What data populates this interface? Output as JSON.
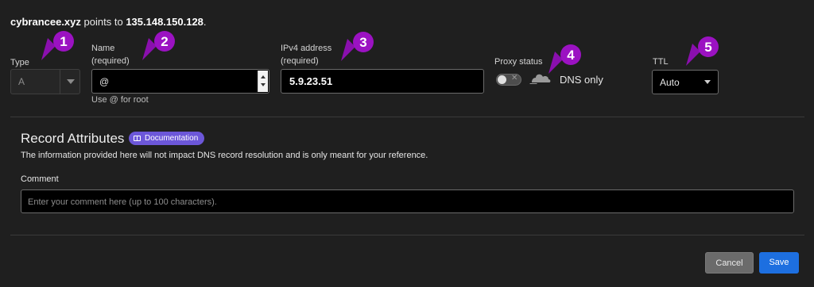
{
  "summary": {
    "domain": "cybrancee.xyz",
    "points_to_text": "points to",
    "ip": "135.148.150.128",
    "period": "."
  },
  "fields": {
    "type": {
      "label": "Type",
      "value": "A"
    },
    "name": {
      "label": "Name",
      "sublabel": "(required)",
      "value": "@",
      "hint": "Use @ for root"
    },
    "ipv4": {
      "label": "IPv4 address",
      "sublabel": "(required)",
      "value": "5.9.23.51"
    },
    "proxy": {
      "label": "Proxy status",
      "toggle_icon": "x-icon",
      "status_icon": "cloud-icon",
      "status_text": "DNS only",
      "enabled": false
    },
    "ttl": {
      "label": "TTL",
      "value": "Auto"
    }
  },
  "record_attributes": {
    "title": "Record Attributes",
    "doc_badge": "Documentation",
    "description": "The information provided here will not impact DNS record resolution and is only meant for your reference.",
    "comment_label": "Comment",
    "comment_placeholder": "Enter your comment here (up to 100 characters)."
  },
  "actions": {
    "cancel": "Cancel",
    "save": "Save"
  },
  "annotations": [
    "1",
    "2",
    "3",
    "4",
    "5"
  ],
  "colors": {
    "background": "#1f1f1f",
    "annotation": "#9b12c2",
    "save": "#1d6fe0",
    "cancel": "#6b6b6b",
    "badge": "#6c57d9"
  }
}
